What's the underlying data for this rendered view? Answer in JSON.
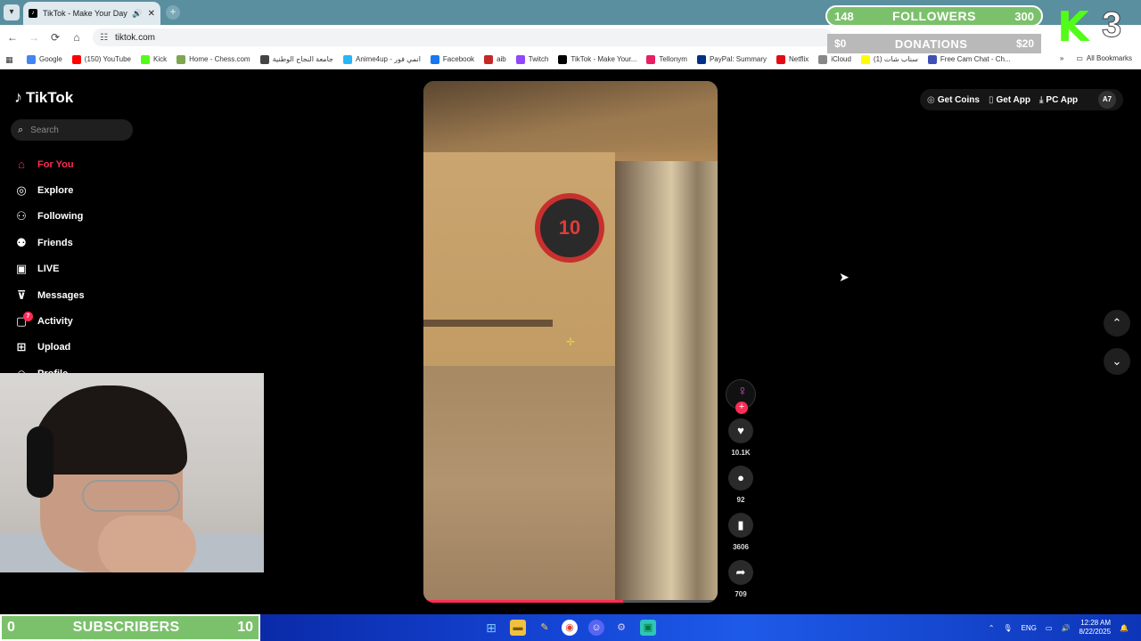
{
  "browser": {
    "tab_title": "TikTok - Make Your Day",
    "url": "tiktok.com",
    "bookmarks": [
      {
        "label": "Google",
        "color": "#4285f4"
      },
      {
        "label": "(150) YouTube",
        "color": "#ff0000"
      },
      {
        "label": "Kick",
        "color": "#53fc18"
      },
      {
        "label": "Home - Chess.com",
        "color": "#7fa650"
      },
      {
        "label": "جامعة النجاح الوطنية",
        "color": "#444444"
      },
      {
        "label": "Anime4up - انمي فور",
        "color": "#29b6f6"
      },
      {
        "label": "Facebook",
        "color": "#1877f2"
      },
      {
        "label": "aib",
        "color": "#c62828"
      },
      {
        "label": "Twitch",
        "color": "#9146ff"
      },
      {
        "label": "TikTok - Make Your...",
        "color": "#000000"
      },
      {
        "label": "Tellonym",
        "color": "#e91e63"
      },
      {
        "label": "PayPal: Summary",
        "color": "#003087"
      },
      {
        "label": "Netflix",
        "color": "#e50914"
      },
      {
        "label": "iCloud",
        "color": "#888888"
      },
      {
        "label": "(1) سناب شات",
        "color": "#fffc00"
      },
      {
        "label": "Free Cam Chat - Ch...",
        "color": "#3f51b5"
      }
    ],
    "all_bookmarks": "All Bookmarks"
  },
  "overlay": {
    "followers_current": "148",
    "followers_label": "FOLLOWERS",
    "followers_goal": "300",
    "donations_current": "$0",
    "donations_label": "DONATIONS",
    "donations_goal": "$20",
    "kick_letter": "K",
    "kick_number": "3",
    "subscribers_current": "0",
    "subscribers_label": "SUBSCRIBERS",
    "subscribers_goal": "10"
  },
  "tiktok": {
    "logo": "TikTok",
    "search_placeholder": "Search",
    "nav": [
      {
        "label": "For You",
        "icon": "home-icon",
        "active": true
      },
      {
        "label": "Explore",
        "icon": "compass-icon"
      },
      {
        "label": "Following",
        "icon": "following-icon"
      },
      {
        "label": "Friends",
        "icon": "friends-icon"
      },
      {
        "label": "LIVE",
        "icon": "live-icon"
      },
      {
        "label": "Messages",
        "icon": "messages-icon"
      },
      {
        "label": "Activity",
        "icon": "activity-icon",
        "badge": "7"
      },
      {
        "label": "Upload",
        "icon": "upload-icon"
      },
      {
        "label": "Profile",
        "icon": "profile-icon"
      }
    ],
    "top_buttons": {
      "get_coins": "Get Coins",
      "get_app": "Get App",
      "pc_app": "PC App",
      "avatar": "A7"
    },
    "video": {
      "timer": "10",
      "progress_fraction": 0.68
    },
    "actions": {
      "likes": "10.1K",
      "comments": "92",
      "saves": "3606",
      "shares": "709"
    }
  },
  "taskbar": {
    "language": "ENG",
    "time": "12:28 AM",
    "date": "8/22/2025"
  }
}
